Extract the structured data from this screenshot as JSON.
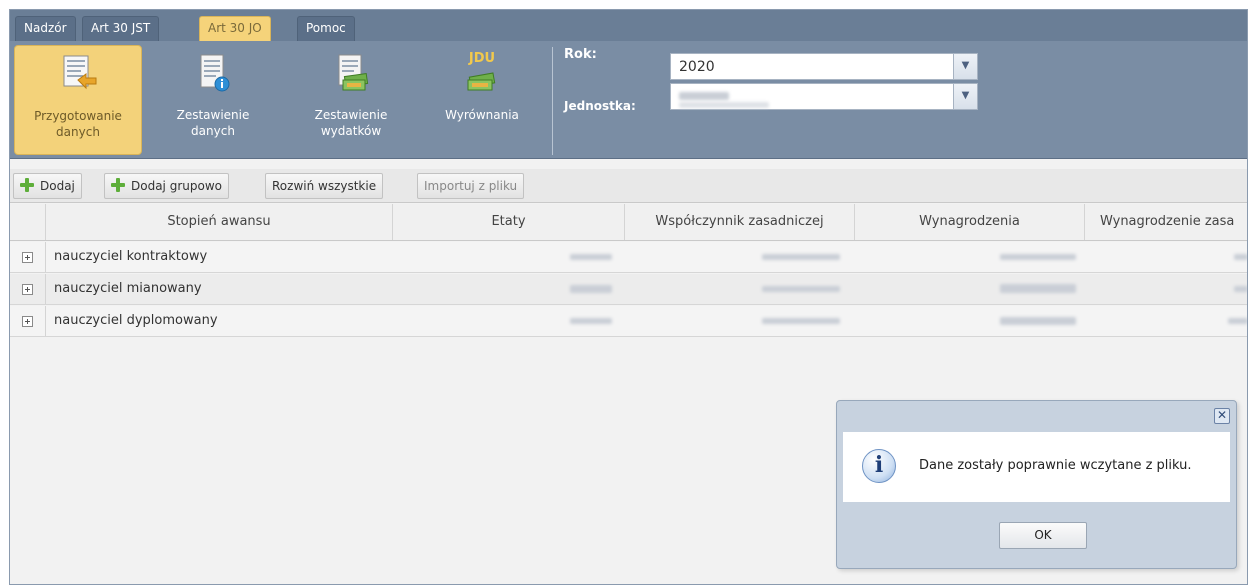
{
  "tabs": [
    "Nadzór",
    "Art 30 JST",
    "Art 30 JO",
    "Pomoc"
  ],
  "active_tab": "Art 30 JO",
  "ribbon": {
    "buttons": [
      {
        "label": "Przygotowanie danych",
        "line1": "Przygotowanie",
        "line2": "danych",
        "active": true
      },
      {
        "label": "Zestawienie danych",
        "line1": "Zestawienie",
        "line2": "danych",
        "active": false
      },
      {
        "label": "Zestawienie wydatków",
        "line1": "Zestawienie",
        "line2": "wydatków",
        "active": false
      },
      {
        "label": "Wyrównania",
        "line1": "Wyrównania",
        "line2": "",
        "active": false
      }
    ],
    "jdu_badge": "JDU",
    "rok_label": "Rok:",
    "rok_value": "2020",
    "jednostka_label": "Jednostka:",
    "jednostka_value": ""
  },
  "toolbar": {
    "dodaj": "Dodaj",
    "dodaj_grupowo": "Dodaj grupowo",
    "rozwin_wszystkie": "Rozwiń wszystkie",
    "importuj": "Importuj z pliku"
  },
  "grid": {
    "columns": [
      "Stopień awansu",
      "Etaty",
      "Współczynnik zasadniczej",
      "Wynagrodzenia",
      "Wynagrodzenie zasa"
    ],
    "rows": [
      {
        "label": "nauczyciel kontraktowy"
      },
      {
        "label": "nauczyciel mianowany"
      },
      {
        "label": "nauczyciel dyplomowany"
      }
    ]
  },
  "dialog": {
    "message": "Dane zostały poprawnie wczytane z pliku.",
    "ok": "OK",
    "icon": "info-icon"
  },
  "colors": {
    "tabbar": "#6a7e96",
    "ribbon": "#7a8da4",
    "active_tab": "#f5d37a",
    "dialog_frame": "#c7d2df"
  }
}
